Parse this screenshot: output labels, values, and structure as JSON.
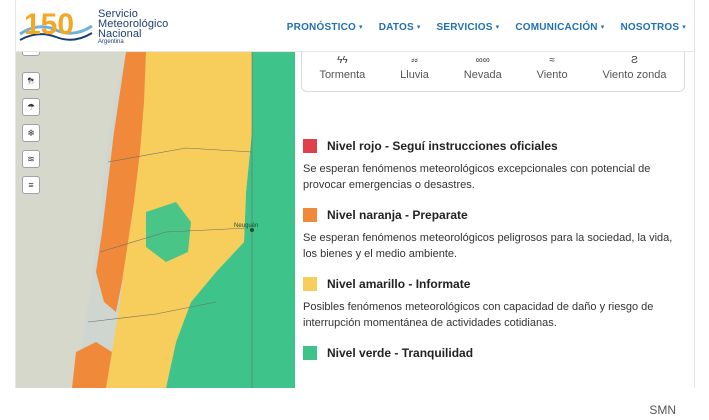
{
  "header": {
    "logo_number": "150",
    "logo_line1": "Servicio",
    "logo_line2": "Meteorológico",
    "logo_line3": "Nacional",
    "logo_line4": "Argentina",
    "nav": [
      {
        "label": "PRONÓSTICO"
      },
      {
        "label": "DATOS"
      },
      {
        "label": "SERVICIOS"
      },
      {
        "label": "COMUNICACIÓN"
      },
      {
        "label": "NOSOTROS"
      }
    ]
  },
  "map": {
    "city": "Neuquén",
    "colors": {
      "red": "#e0404c",
      "orange": "#f08a3a",
      "yellow": "#f7cd5b",
      "green": "#3ec48a",
      "land": "#d6d8cc"
    }
  },
  "phenomena": [
    {
      "label": "Tormenta",
      "icon": "storm-icon"
    },
    {
      "label": "Lluvia",
      "icon": "rain-icon"
    },
    {
      "label": "Nevada",
      "icon": "snow-icon"
    },
    {
      "label": "Viento",
      "icon": "wind-icon"
    },
    {
      "label": "Viento zonda",
      "icon": "zonda-wind-icon"
    }
  ],
  "levels": [
    {
      "color": "#e0404c",
      "title": "Nivel rojo - Seguí instrucciones oficiales",
      "desc": "Se esperan fenómenos meteorológicos excepcionales con potencial de provocar emergencias o desastres."
    },
    {
      "color": "#f08a3a",
      "title": "Nivel naranja - Preparate",
      "desc": "Se esperan fenómenos meteorológicos peligrosos para la sociedad, la vida, los bienes y el medio ambiente."
    },
    {
      "color": "#f7cd5b",
      "title": "Nivel amarillo - Informate",
      "desc": "Posibles fenómenos meteorológicos con capacidad de daño y riesgo de interrupción momentánea de actividades cotidianas."
    },
    {
      "color": "#3ec48a",
      "title": "Nivel verde - Tranquilidad",
      "desc": ""
    }
  ],
  "credit": "SMN"
}
